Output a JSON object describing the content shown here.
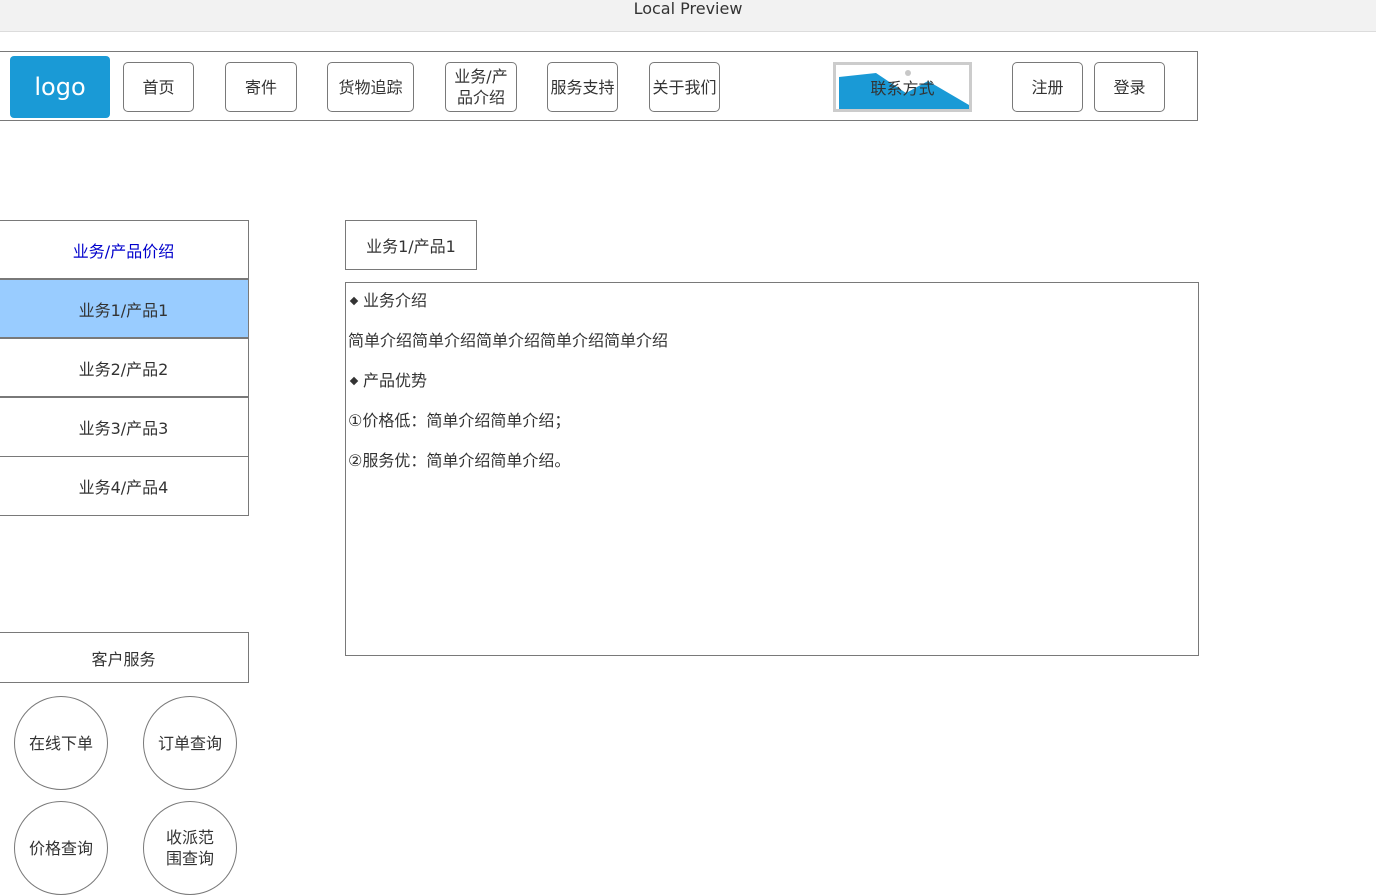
{
  "window": {
    "title": "Local Preview"
  },
  "header": {
    "logo": "logo",
    "nav": [
      {
        "label": "首页"
      },
      {
        "label": "寄件"
      },
      {
        "label": "货物追踪"
      },
      {
        "label": "业务/产品介绍",
        "line1": "业务/产",
        "line2": "品介绍"
      },
      {
        "label": "服务支持"
      },
      {
        "label": "关于我们"
      }
    ],
    "contact_label": "联系方式",
    "register_label": "注册",
    "login_label": "登录"
  },
  "sidebar": {
    "title": "业务/产品价绍",
    "items": [
      {
        "label": "业务1/产品1",
        "active": true
      },
      {
        "label": "业务2/产品2",
        "active": false
      },
      {
        "label": "业务3/产品3",
        "active": false
      },
      {
        "label": "业务4/产品4",
        "active": false
      }
    ]
  },
  "content": {
    "tab_label": "业务1/产品1",
    "section1_heading": "业务介绍",
    "section1_text": "简单介绍简单介绍简单介绍简单介绍简单介绍",
    "section2_heading": "产品优势",
    "point1": "①价格低：简单介绍简单介绍；",
    "point2": "②服务优：简单介绍简单介绍。"
  },
  "customer_service": {
    "title": "客户服务",
    "buttons": [
      {
        "label": "在线下单"
      },
      {
        "label": "订单查询"
      },
      {
        "label": "价格查询"
      },
      {
        "label": "收派范围查询",
        "line1": "收派范",
        "line2": "围查询"
      }
    ]
  },
  "colors": {
    "logo_bg": "#1a9ad6",
    "active_item_bg": "#99ccff",
    "sidebar_title_text": "#0000cc",
    "border": "#797979"
  },
  "icons": {
    "contact_image": "image-placeholder-icon",
    "bullet": "diamond-bullet-icon"
  }
}
